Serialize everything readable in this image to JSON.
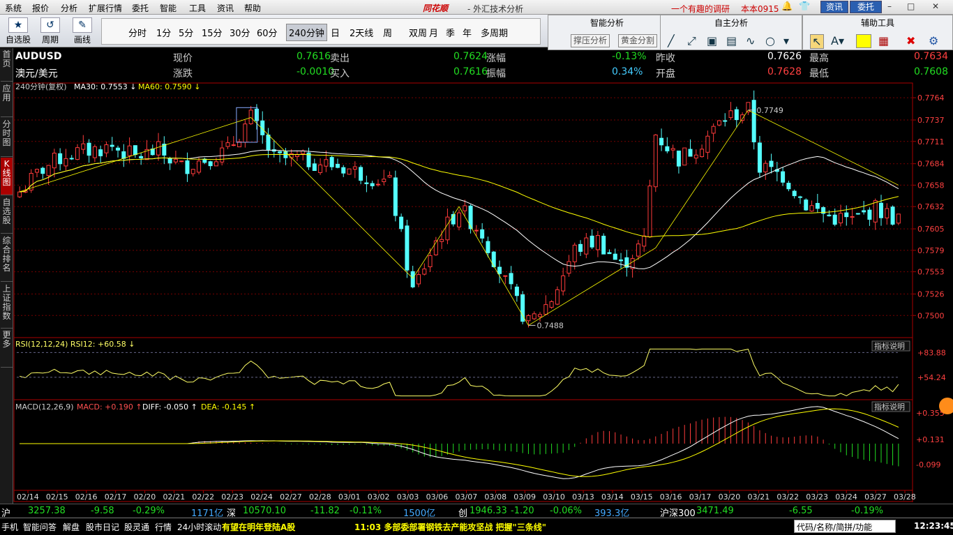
{
  "menu": [
    "系统",
    "报价",
    "分析",
    "扩展行情",
    "委托",
    "智能",
    "工具",
    "资讯",
    "帮助"
  ],
  "brand": "同花顺",
  "subtitle": "- 外汇技术分析",
  "promo": "一个有趣的调研",
  "account": "本本0915",
  "win_buttons": {
    "news": "资讯",
    "trade": "委托"
  },
  "tools": [
    {
      "icon": "★",
      "label": "自选股"
    },
    {
      "icon": "↺",
      "label": "周期"
    },
    {
      "icon": "✎",
      "label": "画线"
    }
  ],
  "periods": [
    "分时",
    "1分",
    "5分",
    "15分",
    "30分",
    "60分",
    "240分钟",
    "日",
    "2天线",
    "周",
    "双周",
    "月",
    "季",
    "年",
    "多周期"
  ],
  "active_period": "240分钟",
  "panels": {
    "smart": "智能分析",
    "self": "自主分析",
    "aux": "辅助工具",
    "support": "撑压分析",
    "golden": "黄金分割"
  },
  "side_tabs": [
    "首页",
    "应用",
    "分时图",
    "K线图",
    "自选股",
    "综合排名",
    "上证指数",
    "更多"
  ],
  "quote": {
    "symbol": "AUDUSD",
    "name": "澳元/美元",
    "row1": [
      [
        "现价",
        "0.7616",
        "卖出",
        "0.7624",
        "涨幅",
        "-0.13%",
        "昨收",
        "0.7626",
        "最高",
        "0.7634"
      ]
    ],
    "row2": [
      [
        "涨跌",
        "-0.0010",
        "买入",
        "0.7616",
        "振幅",
        "0.34%",
        "开盘",
        "0.7628",
        "最低",
        "0.7608"
      ]
    ],
    "colors": {
      "up": "#ff4040",
      "down": "#22dd22",
      "label": "#cccccc"
    }
  },
  "chart_data": {
    "type": "candlestick",
    "title": "240分钟(复权)",
    "ma": [
      {
        "name": "MA30",
        "value": "0.7553",
        "color": "#ffffff"
      },
      {
        "name": "MA60",
        "value": "0.7590",
        "color": "#ffff00"
      }
    ],
    "ylim": [
      0.7485,
      0.777
    ],
    "y_ticks": [
      "0.7764",
      "0.7737",
      "0.7711",
      "0.7684",
      "0.7658",
      "0.7632",
      "0.7605",
      "0.7579",
      "0.7553",
      "0.7526",
      "0.7500"
    ],
    "x_ticks": [
      "02/14",
      "02/15",
      "02/16",
      "02/17",
      "02/20",
      "02/21",
      "02/22",
      "02/23",
      "02/24",
      "02/27",
      "02/28",
      "03/01",
      "03/02",
      "03/03",
      "03/06",
      "03/07",
      "03/08",
      "03/09",
      "03/10",
      "03/13",
      "03/14",
      "03/15",
      "03/16",
      "03/17",
      "03/20",
      "03/21",
      "03/22",
      "03/23",
      "03/24",
      "03/27",
      "03/28"
    ],
    "annotations": [
      {
        "text": "0.7749",
        "i": 126
      },
      {
        "text": "0.7488",
        "i": 88
      }
    ],
    "close_keys": [
      [
        0,
        0.765
      ],
      [
        4,
        0.7678
      ],
      [
        8,
        0.7695
      ],
      [
        12,
        0.77
      ],
      [
        16,
        0.7705
      ],
      [
        20,
        0.7692
      ],
      [
        24,
        0.77
      ],
      [
        28,
        0.768
      ],
      [
        32,
        0.769
      ],
      [
        36,
        0.77
      ],
      [
        40,
        0.774
      ],
      [
        44,
        0.769
      ],
      [
        48,
        0.769
      ],
      [
        52,
        0.7685
      ],
      [
        56,
        0.768
      ],
      [
        60,
        0.767
      ],
      [
        64,
        0.766
      ],
      [
        68,
        0.753
      ],
      [
        72,
        0.759
      ],
      [
        76,
        0.763
      ],
      [
        80,
        0.76
      ],
      [
        84,
        0.754
      ],
      [
        88,
        0.749
      ],
      [
        92,
        0.752
      ],
      [
        96,
        0.758
      ],
      [
        100,
        0.7592
      ],
      [
        104,
        0.756
      ],
      [
        108,
        0.759
      ],
      [
        110,
        0.772
      ],
      [
        114,
        0.769
      ],
      [
        118,
        0.771
      ],
      [
        122,
        0.774
      ],
      [
        126,
        0.7749
      ],
      [
        128,
        0.768
      ],
      [
        132,
        0.767
      ],
      [
        136,
        0.7635
      ],
      [
        140,
        0.762
      ],
      [
        144,
        0.7615
      ],
      [
        148,
        0.763
      ],
      [
        152,
        0.7616
      ]
    ],
    "rsi": {
      "name": "RSI(12,12,24)",
      "label": "RSI12: +60.58",
      "ticks": [
        "+83.88",
        "+54.24"
      ],
      "range": [
        30,
        90
      ]
    },
    "macd": {
      "name": "MACD(12,26,9)",
      "macd": "MACD: +0.190",
      "diff": "DIFF: -0.050",
      "dea": "DEA: -0.145",
      "ticks": [
        "+0.355",
        "+0.131",
        "-0.099"
      ]
    },
    "indicator_btn": "指标说明"
  },
  "status1": [
    {
      "t": "沪",
      "c": "#ffffff"
    },
    {
      "t": "3257.38",
      "c": "#22dd22"
    },
    {
      "t": "-9.58",
      "c": "#22dd22"
    },
    {
      "t": "-0.29%",
      "c": "#22dd22"
    },
    {
      "t": "1171亿",
      "c": "#44aaff"
    },
    {
      "t": "深",
      "c": "#ffffff"
    },
    {
      "t": "10570.10",
      "c": "#22dd22"
    },
    {
      "t": "-11.82",
      "c": "#22dd22"
    },
    {
      "t": "-0.11%",
      "c": "#22dd22"
    },
    {
      "t": "1500亿",
      "c": "#44aaff"
    },
    {
      "t": "创",
      "c": "#ffffff"
    },
    {
      "t": "1946.33",
      "c": "#22dd22"
    },
    {
      "t": "-1.20",
      "c": "#22dd22"
    },
    {
      "t": "-0.06%",
      "c": "#22dd22"
    },
    {
      "t": "393.3亿",
      "c": "#44aaff"
    },
    {
      "t": "沪深300",
      "c": "#ffffff"
    },
    {
      "t": "3471.49",
      "c": "#22dd22"
    },
    {
      "t": "-6.55",
      "c": "#22dd22"
    },
    {
      "t": "-0.19%",
      "c": "#22dd22"
    }
  ],
  "status2": {
    "items": [
      "手机",
      "智能问答",
      "解盘",
      "股市日记",
      "股灵通",
      "行情",
      "24小时滚动"
    ],
    "news1": "有望在明年登陆A股",
    "news2": "11:03 多部委部署钢铁去产能攻坚战 把握\"三条线\"",
    "code": "代码/名称/简拼/功能",
    "time": "12:23:45"
  }
}
